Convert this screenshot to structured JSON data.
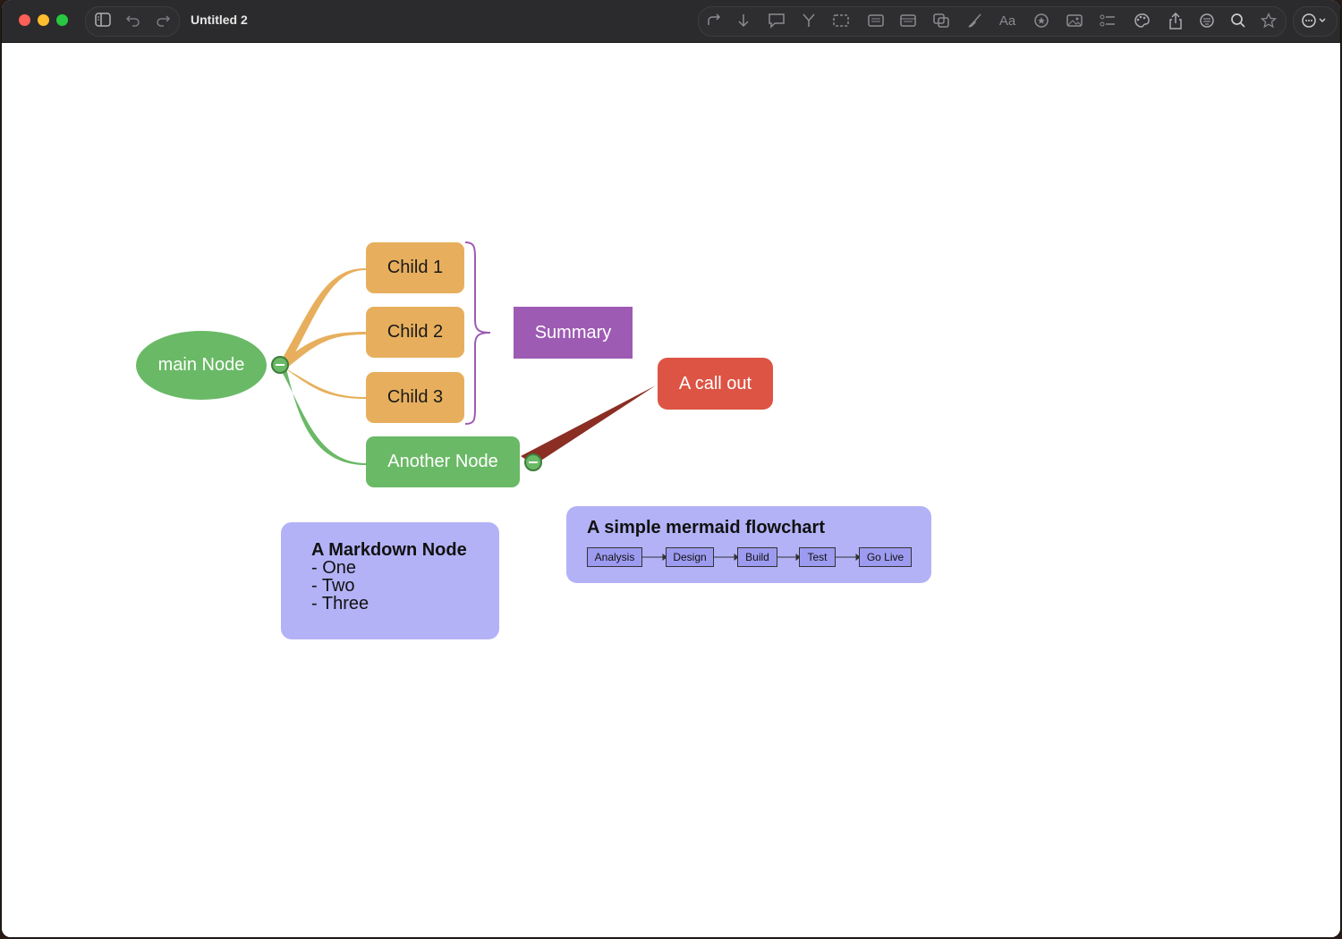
{
  "window": {
    "title": "Untitled 2"
  },
  "toolbar": {
    "icons": [
      "sidebar-icon",
      "undo-icon",
      "redo-icon",
      "connect-icon",
      "add-child-icon",
      "callout-icon",
      "branch-icon",
      "boundary-icon",
      "markdown-icon",
      "table-icon",
      "copy-style-icon",
      "paintbrush-icon",
      "font-icon",
      "sticker-icon",
      "image-icon",
      "outline-icon",
      "theme-icon",
      "share-icon",
      "focus-icon",
      "search-icon",
      "favorite-icon",
      "more-icon"
    ],
    "font_label": "Aa"
  },
  "mindmap": {
    "main_node": "main Node",
    "children": [
      "Child 1",
      "Child 2",
      "Child 3"
    ],
    "another_node": "Another Node",
    "summary": "Summary",
    "callout": "A call out",
    "colors": {
      "main": "#6ab966",
      "child": "#e7af5d",
      "summary": "#9d5bb3",
      "callout": "#dd5444",
      "markdown": "#b3b2f7",
      "callout_link": "#8b2e24"
    }
  },
  "markdown_node": {
    "title": "A Markdown Node",
    "items": [
      "- One",
      "- Two",
      "- Three"
    ]
  },
  "mermaid_node": {
    "title": "A simple mermaid flowchart",
    "steps": [
      "Analysis",
      "Design",
      "Build",
      "Test",
      "Go Live"
    ]
  }
}
